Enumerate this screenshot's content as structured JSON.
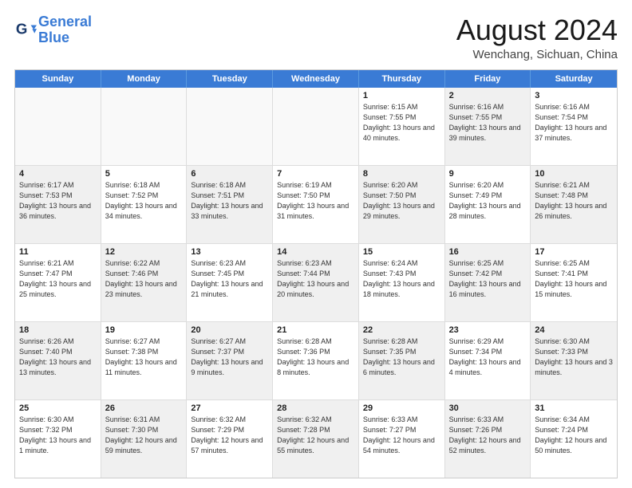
{
  "logo": {
    "line1": "General",
    "line2": "Blue"
  },
  "title": "August 2024",
  "subtitle": "Wenchang, Sichuan, China",
  "days": [
    "Sunday",
    "Monday",
    "Tuesday",
    "Wednesday",
    "Thursday",
    "Friday",
    "Saturday"
  ],
  "weeks": [
    [
      {
        "day": "",
        "sunrise": "",
        "sunset": "",
        "daylight": "",
        "shaded": false,
        "empty": true
      },
      {
        "day": "",
        "sunrise": "",
        "sunset": "",
        "daylight": "",
        "shaded": false,
        "empty": true
      },
      {
        "day": "",
        "sunrise": "",
        "sunset": "",
        "daylight": "",
        "shaded": false,
        "empty": true
      },
      {
        "day": "",
        "sunrise": "",
        "sunset": "",
        "daylight": "",
        "shaded": false,
        "empty": true
      },
      {
        "day": "1",
        "sunrise": "6:15 AM",
        "sunset": "7:55 PM",
        "daylight": "13 hours and 40 minutes.",
        "shaded": false,
        "empty": false
      },
      {
        "day": "2",
        "sunrise": "6:16 AM",
        "sunset": "7:55 PM",
        "daylight": "13 hours and 39 minutes.",
        "shaded": true,
        "empty": false
      },
      {
        "day": "3",
        "sunrise": "6:16 AM",
        "sunset": "7:54 PM",
        "daylight": "13 hours and 37 minutes.",
        "shaded": false,
        "empty": false
      }
    ],
    [
      {
        "day": "4",
        "sunrise": "6:17 AM",
        "sunset": "7:53 PM",
        "daylight": "13 hours and 36 minutes.",
        "shaded": true,
        "empty": false
      },
      {
        "day": "5",
        "sunrise": "6:18 AM",
        "sunset": "7:52 PM",
        "daylight": "13 hours and 34 minutes.",
        "shaded": false,
        "empty": false
      },
      {
        "day": "6",
        "sunrise": "6:18 AM",
        "sunset": "7:51 PM",
        "daylight": "13 hours and 33 minutes.",
        "shaded": true,
        "empty": false
      },
      {
        "day": "7",
        "sunrise": "6:19 AM",
        "sunset": "7:50 PM",
        "daylight": "13 hours and 31 minutes.",
        "shaded": false,
        "empty": false
      },
      {
        "day": "8",
        "sunrise": "6:20 AM",
        "sunset": "7:50 PM",
        "daylight": "13 hours and 29 minutes.",
        "shaded": true,
        "empty": false
      },
      {
        "day": "9",
        "sunrise": "6:20 AM",
        "sunset": "7:49 PM",
        "daylight": "13 hours and 28 minutes.",
        "shaded": false,
        "empty": false
      },
      {
        "day": "10",
        "sunrise": "6:21 AM",
        "sunset": "7:48 PM",
        "daylight": "13 hours and 26 minutes.",
        "shaded": true,
        "empty": false
      }
    ],
    [
      {
        "day": "11",
        "sunrise": "6:21 AM",
        "sunset": "7:47 PM",
        "daylight": "13 hours and 25 minutes.",
        "shaded": false,
        "empty": false
      },
      {
        "day": "12",
        "sunrise": "6:22 AM",
        "sunset": "7:46 PM",
        "daylight": "13 hours and 23 minutes.",
        "shaded": true,
        "empty": false
      },
      {
        "day": "13",
        "sunrise": "6:23 AM",
        "sunset": "7:45 PM",
        "daylight": "13 hours and 21 minutes.",
        "shaded": false,
        "empty": false
      },
      {
        "day": "14",
        "sunrise": "6:23 AM",
        "sunset": "7:44 PM",
        "daylight": "13 hours and 20 minutes.",
        "shaded": true,
        "empty": false
      },
      {
        "day": "15",
        "sunrise": "6:24 AM",
        "sunset": "7:43 PM",
        "daylight": "13 hours and 18 minutes.",
        "shaded": false,
        "empty": false
      },
      {
        "day": "16",
        "sunrise": "6:25 AM",
        "sunset": "7:42 PM",
        "daylight": "13 hours and 16 minutes.",
        "shaded": true,
        "empty": false
      },
      {
        "day": "17",
        "sunrise": "6:25 AM",
        "sunset": "7:41 PM",
        "daylight": "13 hours and 15 minutes.",
        "shaded": false,
        "empty": false
      }
    ],
    [
      {
        "day": "18",
        "sunrise": "6:26 AM",
        "sunset": "7:40 PM",
        "daylight": "13 hours and 13 minutes.",
        "shaded": true,
        "empty": false
      },
      {
        "day": "19",
        "sunrise": "6:27 AM",
        "sunset": "7:38 PM",
        "daylight": "13 hours and 11 minutes.",
        "shaded": false,
        "empty": false
      },
      {
        "day": "20",
        "sunrise": "6:27 AM",
        "sunset": "7:37 PM",
        "daylight": "13 hours and 9 minutes.",
        "shaded": true,
        "empty": false
      },
      {
        "day": "21",
        "sunrise": "6:28 AM",
        "sunset": "7:36 PM",
        "daylight": "13 hours and 8 minutes.",
        "shaded": false,
        "empty": false
      },
      {
        "day": "22",
        "sunrise": "6:28 AM",
        "sunset": "7:35 PM",
        "daylight": "13 hours and 6 minutes.",
        "shaded": true,
        "empty": false
      },
      {
        "day": "23",
        "sunrise": "6:29 AM",
        "sunset": "7:34 PM",
        "daylight": "13 hours and 4 minutes.",
        "shaded": false,
        "empty": false
      },
      {
        "day": "24",
        "sunrise": "6:30 AM",
        "sunset": "7:33 PM",
        "daylight": "13 hours and 3 minutes.",
        "shaded": true,
        "empty": false
      }
    ],
    [
      {
        "day": "25",
        "sunrise": "6:30 AM",
        "sunset": "7:32 PM",
        "daylight": "13 hours and 1 minute.",
        "shaded": false,
        "empty": false
      },
      {
        "day": "26",
        "sunrise": "6:31 AM",
        "sunset": "7:30 PM",
        "daylight": "12 hours and 59 minutes.",
        "shaded": true,
        "empty": false
      },
      {
        "day": "27",
        "sunrise": "6:32 AM",
        "sunset": "7:29 PM",
        "daylight": "12 hours and 57 minutes.",
        "shaded": false,
        "empty": false
      },
      {
        "day": "28",
        "sunrise": "6:32 AM",
        "sunset": "7:28 PM",
        "daylight": "12 hours and 55 minutes.",
        "shaded": true,
        "empty": false
      },
      {
        "day": "29",
        "sunrise": "6:33 AM",
        "sunset": "7:27 PM",
        "daylight": "12 hours and 54 minutes.",
        "shaded": false,
        "empty": false
      },
      {
        "day": "30",
        "sunrise": "6:33 AM",
        "sunset": "7:26 PM",
        "daylight": "12 hours and 52 minutes.",
        "shaded": true,
        "empty": false
      },
      {
        "day": "31",
        "sunrise": "6:34 AM",
        "sunset": "7:24 PM",
        "daylight": "12 hours and 50 minutes.",
        "shaded": false,
        "empty": false
      }
    ]
  ],
  "labels": {
    "sunrise": "Sunrise: ",
    "sunset": "Sunset: ",
    "daylight": "Daylight: "
  }
}
